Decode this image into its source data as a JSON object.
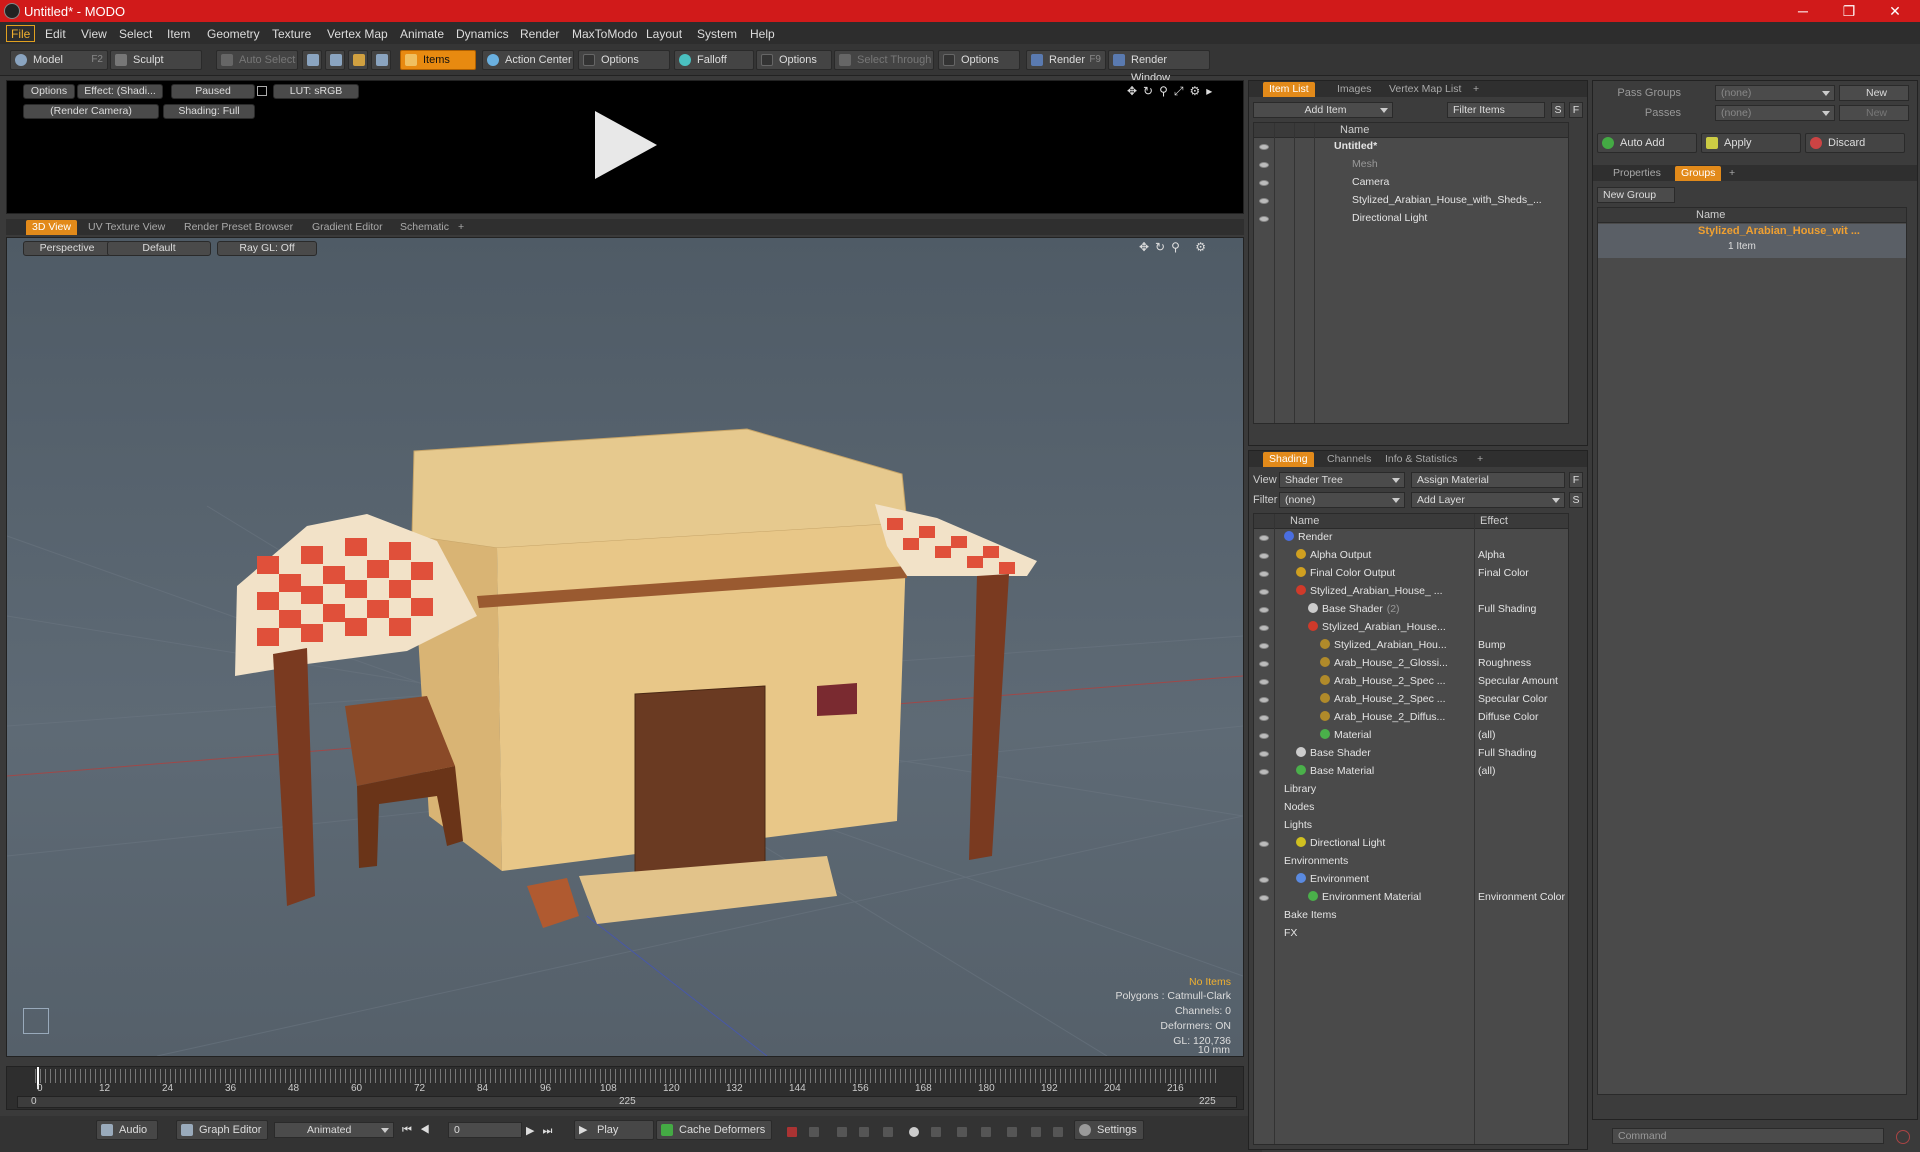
{
  "window": {
    "title": "Untitled* - MODO"
  },
  "menu": [
    "File",
    "Edit",
    "View",
    "Select",
    "Item",
    "Geometry",
    "Texture",
    "Vertex Map",
    "Animate",
    "Dynamics",
    "Render",
    "MaxToModo",
    "Layout",
    "System",
    "Help"
  ],
  "toolbar": {
    "model": "Model",
    "model_key": "F2",
    "sculpt": "Sculpt",
    "auto_select": "Auto Select",
    "items": "Items",
    "action_center": "Action Center",
    "options1": "Options",
    "falloff": "Falloff",
    "options2": "Options",
    "select_through": "Select Through",
    "options3": "Options",
    "render": "Render",
    "render_key": "F9",
    "render_window": "Render Window"
  },
  "preview": {
    "options": "Options",
    "effect": "Effect: (Shadi...",
    "paused": "Paused",
    "lut": "LUT: sRGB",
    "camera": "(Render Camera)",
    "shading": "Shading: Full"
  },
  "viewport_tabs": [
    "3D View",
    "UV Texture View",
    "Render Preset Browser",
    "Gradient Editor",
    "Schematic"
  ],
  "viewport": {
    "projection": "Perspective",
    "style": "Default",
    "raygl": "Ray GL: Off",
    "stats": [
      "No Items",
      "Polygons : Catmull-Clark",
      "Channels: 0",
      "Deformers: ON",
      "GL: 120,736",
      "10 mm"
    ]
  },
  "item_list": {
    "tabs": [
      "Item List",
      "Images",
      "Vertex Map List"
    ],
    "add_item": "Add Item",
    "filter": "Filter Items",
    "col_name": "Name",
    "items": [
      {
        "label": "Untitled*",
        "indent": 0
      },
      {
        "label": "Mesh",
        "indent": 1
      },
      {
        "label": "Camera",
        "indent": 1
      },
      {
        "label": "Stylized_Arabian_House_with_Sheds_...",
        "indent": 1
      },
      {
        "label": "Directional Light",
        "indent": 1
      }
    ]
  },
  "shading": {
    "tabs": [
      "Shading",
      "Channels",
      "Info & Statistics"
    ],
    "view_label": "View",
    "view_value": "Shader Tree",
    "assign": "Assign Material",
    "filter_label": "Filter",
    "filter_value": "(none)",
    "add_layer": "Add Layer",
    "col_name": "Name",
    "col_effect": "Effect",
    "rows": [
      {
        "label": "Render",
        "indent": 0,
        "effect": "",
        "color": "#4a6ee0"
      },
      {
        "label": "Alpha Output",
        "indent": 1,
        "effect": "Alpha",
        "color": "#d0a020"
      },
      {
        "label": "Final Color Output",
        "indent": 1,
        "effect": "Final Color",
        "color": "#d0a020"
      },
      {
        "label": "Stylized_Arabian_House_ ...",
        "indent": 1,
        "effect": "",
        "color": "#d03a2a"
      },
      {
        "label": "Base Shader",
        "indent": 2,
        "effect": "Full Shading",
        "color": "#cccccc",
        "note": "(2)"
      },
      {
        "label": "Stylized_Arabian_House...",
        "indent": 2,
        "effect": "",
        "color": "#d03a2a"
      },
      {
        "label": "Stylized_Arabian_Hou...",
        "indent": 3,
        "effect": "Bump",
        "color": "#b08a2a"
      },
      {
        "label": "Arab_House_2_Glossi...",
        "indent": 3,
        "effect": "Roughness",
        "color": "#b08a2a"
      },
      {
        "label": "Arab_House_2_Spec ...",
        "indent": 3,
        "effect": "Specular Amount",
        "color": "#b08a2a"
      },
      {
        "label": "Arab_House_2_Spec ...",
        "indent": 3,
        "effect": "Specular Color",
        "color": "#b08a2a"
      },
      {
        "label": "Arab_House_2_Diffus...",
        "indent": 3,
        "effect": "Diffuse Color",
        "color": "#b08a2a"
      },
      {
        "label": "Material",
        "indent": 3,
        "effect": "(all)",
        "color": "#4ab04a"
      },
      {
        "label": "Base Shader",
        "indent": 1,
        "effect": "Full Shading",
        "color": "#cccccc"
      },
      {
        "label": "Base Material",
        "indent": 1,
        "effect": "(all)",
        "color": "#4ab04a"
      },
      {
        "label": "Library",
        "indent": 0,
        "effect": "",
        "color": ""
      },
      {
        "label": "Nodes",
        "indent": 0,
        "effect": "",
        "color": ""
      },
      {
        "label": "Lights",
        "indent": -1,
        "effect": "",
        "color": ""
      },
      {
        "label": "Directional Light",
        "indent": 1,
        "effect": "",
        "color": "#d0c020"
      },
      {
        "label": "Environments",
        "indent": -1,
        "effect": "",
        "color": ""
      },
      {
        "label": "Environment",
        "indent": 1,
        "effect": "",
        "color": "#5a8ae0"
      },
      {
        "label": "Environment Material",
        "indent": 2,
        "effect": "Environment Color",
        "color": "#4ab04a"
      },
      {
        "label": "Bake Items",
        "indent": -1,
        "effect": "",
        "color": ""
      },
      {
        "label": "FX",
        "indent": 0,
        "effect": "",
        "color": ""
      }
    ]
  },
  "groups": {
    "pass_groups": "Pass Groups",
    "pass_value": "(none)",
    "new": "New",
    "passes": "Passes",
    "passes_value": "(none)",
    "new2": "New",
    "auto_add": "Auto Add",
    "apply": "Apply",
    "discard": "Discard",
    "tabs": [
      "Properties",
      "Groups"
    ],
    "new_group": "New Group",
    "col_name": "Name",
    "group_name": "Stylized_Arabian_House_wit ...",
    "group_count": "1 Item"
  },
  "timeline": {
    "ticks": [
      "0",
      "12",
      "24",
      "36",
      "48",
      "60",
      "72",
      "84",
      "96",
      "108",
      "120",
      "132",
      "144",
      "156",
      "168",
      "180",
      "192",
      "204",
      "216"
    ],
    "start": "0",
    "mid": "225",
    "end": "225"
  },
  "bottom": {
    "audio": "Audio",
    "graph_editor": "Graph Editor",
    "animated": "Animated",
    "frame": "0",
    "play": "Play",
    "cache": "Cache Deformers",
    "settings": "Settings",
    "command": "Command"
  },
  "colors": {
    "accent": "#e28a1a",
    "title_bar": "#d11a1a"
  }
}
